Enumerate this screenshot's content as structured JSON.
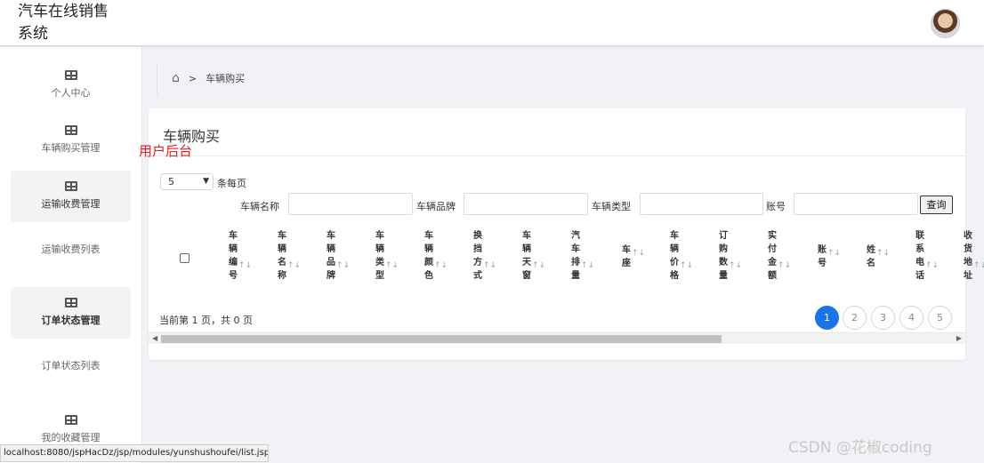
{
  "app": {
    "title": "汽车在线销售系统",
    "title_line1": "汽车在线销售",
    "title_line2": "系统"
  },
  "sidebar": {
    "items": [
      {
        "label": "个人中心",
        "icon": "table-icon"
      },
      {
        "label": "车辆购买管理",
        "icon": "table-icon"
      },
      {
        "label": "运输收费管理",
        "icon": "table-icon",
        "active": true
      },
      {
        "label": "运输收费列表",
        "sub": true
      },
      {
        "label": "订单状态管理",
        "icon": "table-icon",
        "active": true
      },
      {
        "label": "订单状态列表",
        "sub": true
      },
      {
        "label": "我的收藏管理",
        "icon": "table-icon"
      }
    ]
  },
  "overlay": {
    "red_label": "用户后台"
  },
  "breadcrumb": {
    "home_icon": "home-icon",
    "separator": ">",
    "current": "车辆购买"
  },
  "card": {
    "title": "车辆购买"
  },
  "controls": {
    "page_size": "5",
    "page_size_suffix": "条每页",
    "filters": [
      {
        "label": "车辆名称",
        "value": ""
      },
      {
        "label": "车辆品牌",
        "value": ""
      },
      {
        "label": "车辆类型",
        "value": ""
      },
      {
        "label": "账号",
        "value": ""
      }
    ],
    "query_button": "查询"
  },
  "table": {
    "sort_glyph": "↑↓",
    "columns": [
      "车辆编号",
      "车辆名称",
      "车辆品牌",
      "车辆类型",
      "车辆颜色",
      "换挡方式",
      "车辆天窗",
      "汽车排量",
      "车座",
      "车辆价格",
      "订购数量",
      "实付金额",
      "账号",
      "姓名",
      "联系电话",
      "收货地址"
    ],
    "rows": []
  },
  "pagination": {
    "info": "当前第 1 页，共 0 页",
    "pages": [
      "1",
      "2",
      "3",
      "4",
      "5"
    ],
    "current": "1"
  },
  "statusbar": {
    "url": "localhost:8080/jspHacDz/jsp/modules/yunshushoufei/list.jsp"
  },
  "watermark": "CSDN @花椒coding"
}
